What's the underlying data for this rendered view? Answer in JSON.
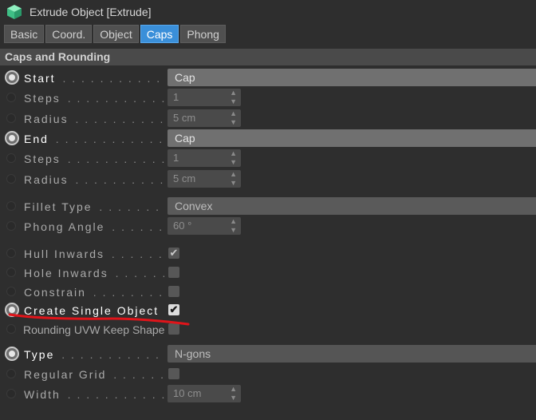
{
  "window": {
    "title": "Extrude Object [Extrude]",
    "icon": "extrude-cube-icon"
  },
  "tabs": [
    {
      "label": "Basic",
      "active": false
    },
    {
      "label": "Coord.",
      "active": false
    },
    {
      "label": "Object",
      "active": false
    },
    {
      "label": "Caps",
      "active": true
    },
    {
      "label": "Phong",
      "active": false
    }
  ],
  "section": {
    "title": "Caps and Rounding"
  },
  "fields": {
    "start": {
      "label": "Start",
      "value": "Cap"
    },
    "start_steps": {
      "label": "Steps",
      "value": "1"
    },
    "start_radius": {
      "label": "Radius",
      "value": "5 cm"
    },
    "end": {
      "label": "End",
      "value": "Cap"
    },
    "end_steps": {
      "label": "Steps",
      "value": "1"
    },
    "end_radius": {
      "label": "Radius",
      "value": "5 cm"
    },
    "fillet_type": {
      "label": "Fillet Type",
      "value": "Convex"
    },
    "phong_angle": {
      "label": "Phong Angle",
      "value": "60 °"
    },
    "hull_inwards": {
      "label": "Hull Inwards",
      "checked": true
    },
    "hole_inwards": {
      "label": "Hole Inwards",
      "checked": false
    },
    "constrain": {
      "label": "Constrain",
      "checked": false
    },
    "create_single_object": {
      "label": "Create Single Object",
      "checked": true
    },
    "rounding_uvw": {
      "label": "Rounding UVW Keep Shape",
      "checked": false
    },
    "type": {
      "label": "Type",
      "value": "N-gons"
    },
    "regular_grid": {
      "label": "Regular Grid",
      "checked": false
    },
    "width": {
      "label": "Width",
      "value": "10 cm"
    }
  },
  "colors": {
    "accent_tab": "#3a8fd9",
    "annotation": "#e0141a",
    "background": "#2e2e2e"
  }
}
